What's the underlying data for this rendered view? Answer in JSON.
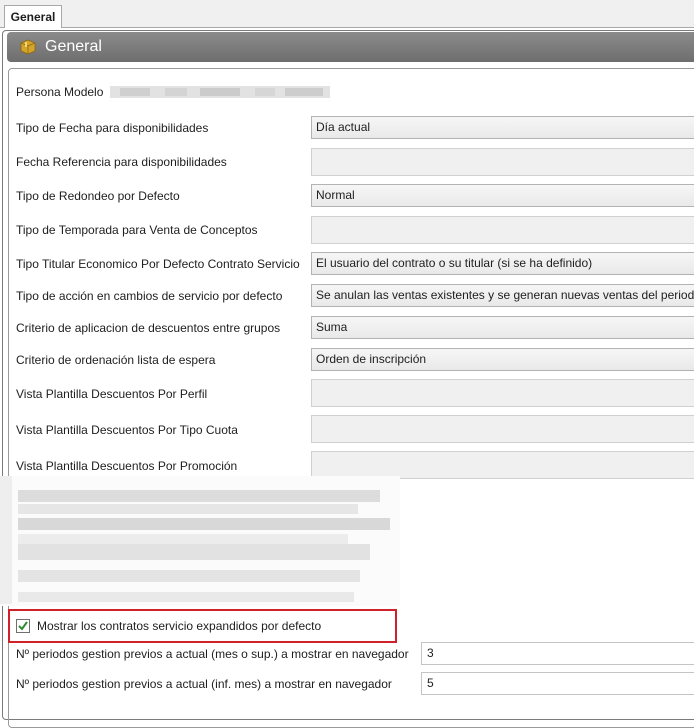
{
  "tab": {
    "label": "General"
  },
  "header": {
    "title": "General",
    "icon": "package-icon",
    "bg_color": "#7d7d7d"
  },
  "persona_modelo": {
    "label": "Persona Modelo"
  },
  "rows": [
    {
      "label": "Tipo de Fecha para disponibilidades",
      "value": "Día actual",
      "kind": "select"
    },
    {
      "label": "Fecha Referencia para disponibilidades",
      "value": "",
      "kind": "disabled"
    },
    {
      "label": "Tipo de Redondeo por Defecto",
      "value": "Normal",
      "kind": "select"
    },
    {
      "label": "Tipo de Temporada para Venta de Conceptos",
      "value": "",
      "kind": "disabled"
    },
    {
      "label": "Tipo Titular Economico Por Defecto Contrato Servicio",
      "value": "El usuario del contrato o su titular (si se ha definido)",
      "kind": "select"
    },
    {
      "label": "Tipo de acción en cambios de servicio por defecto",
      "value": "Se anulan las ventas existentes y se generan nuevas ventas del periodo",
      "kind": "select"
    },
    {
      "label": "Criterio de aplicacion de descuentos entre grupos",
      "value": "Suma",
      "kind": "select"
    },
    {
      "label": "Criterio de ordenación lista de espera",
      "value": "Orden de inscripción",
      "kind": "select"
    },
    {
      "label": "Vista Plantilla Descuentos Por Perfil",
      "value": "",
      "kind": "disabled"
    },
    {
      "label": "Vista Plantilla Descuentos Por Tipo Cuota",
      "value": "",
      "kind": "disabled"
    },
    {
      "label": "Vista Plantilla Descuentos Por Promoción",
      "value": "",
      "kind": "disabled"
    }
  ],
  "checkbox_expandidos": {
    "label": "Mostrar los contratos servicio expandidos por defecto",
    "checked": true
  },
  "periodos_sup": {
    "label": "Nº periodos gestion previos a actual (mes o sup.) a mostrar en navegador",
    "value": "3"
  },
  "periodos_inf": {
    "label": "Nº periodos gestion previos a actual (inf. mes) a mostrar en navegador",
    "value": "5"
  },
  "colors": {
    "highlight": "#d0202a",
    "check": "#2e8b2e"
  }
}
